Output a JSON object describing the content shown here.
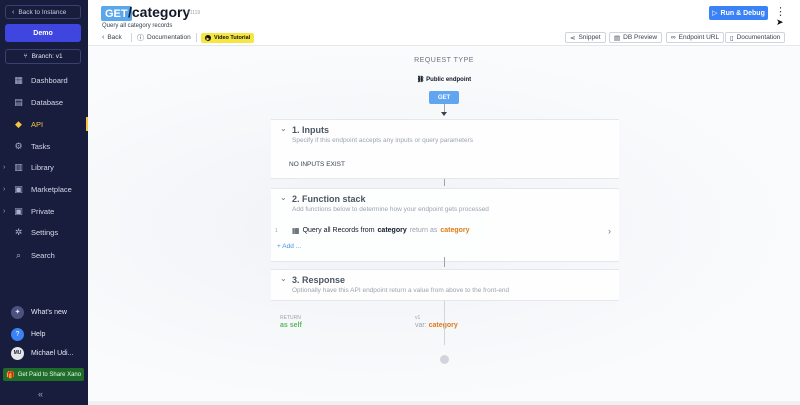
{
  "sidebar": {
    "back_label": "Back to Instance",
    "workspace": "Demo",
    "branch": "Branch: v1",
    "nav": [
      {
        "label": "Dashboard",
        "icon": "dashboard-icon",
        "caret": false,
        "active": false
      },
      {
        "label": "Database",
        "icon": "database-icon",
        "caret": false,
        "active": false
      },
      {
        "label": "API",
        "icon": "api-icon",
        "caret": false,
        "active": true
      },
      {
        "label": "Tasks",
        "icon": "tasks-icon",
        "caret": false,
        "active": false
      },
      {
        "label": "Library",
        "icon": "library-icon",
        "caret": true,
        "active": false
      },
      {
        "label": "Marketplace",
        "icon": "marketplace-icon",
        "caret": true,
        "active": false
      },
      {
        "label": "Private",
        "icon": "private-icon",
        "caret": true,
        "active": false
      },
      {
        "label": "Settings",
        "icon": "settings-icon",
        "caret": false,
        "active": false
      },
      {
        "label": "Search",
        "icon": "search-icon",
        "caret": false,
        "active": false
      }
    ],
    "whats_new": "What's new",
    "help": "Help",
    "user_initials": "MU",
    "user_name": "Michael Udi...",
    "share": "Get Paid to Share Xano"
  },
  "header": {
    "method": "GET",
    "path": "/category",
    "endpoint_id": "#1119",
    "description": "Query all category records",
    "back": "Back",
    "documentation": "Documentation",
    "video_tutorial": "Video Tutorial",
    "run_debug": "Run & Debug",
    "right_buttons": [
      "Snippet",
      "DB Preview",
      "Endpoint URL",
      "Documentation"
    ]
  },
  "canvas": {
    "request_type": "REQUEST TYPE",
    "public_endpoint": "Public endpoint",
    "get_node": "GET",
    "inputs": {
      "title": "1. Inputs",
      "subtitle": "Specify if this endpoint accepts any inputs or query parameters",
      "empty": "NO INPUTS EXIST"
    },
    "function_stack": {
      "title": "2. Function stack",
      "subtitle": "Add functions below to determine how your endpoint gets processed",
      "row_number": "1",
      "row_prefix": "Query all Records from",
      "row_table": "category",
      "row_return": "return as",
      "row_var": "category",
      "add": "+ Add ..."
    },
    "response": {
      "title": "3. Response",
      "subtitle": "Optionally have this API endpoint return a value from above to the front-end",
      "return_label": "RETURN",
      "return_value": "as self",
      "var_label": "v1",
      "var_prefix": "var:",
      "var_name": "category"
    }
  },
  "colors": {
    "sidebar_bg": "#181d3d",
    "accent_blue": "#3b82f6",
    "active_yellow": "#f5c542",
    "orange": "#e07b1a",
    "green": "#5cb85c"
  }
}
